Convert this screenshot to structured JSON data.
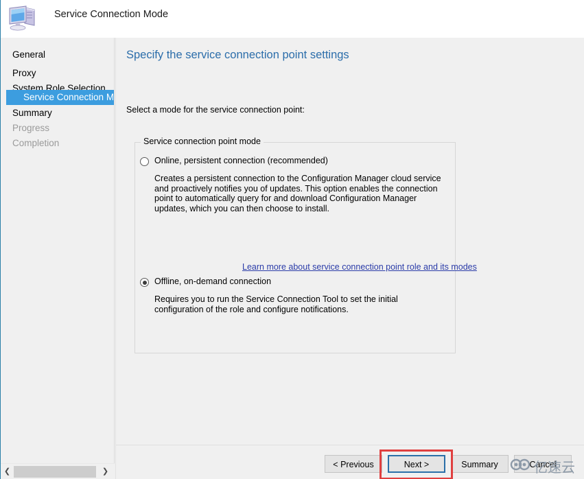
{
  "window": {
    "title": "Service Connection Mode",
    "icon": "computer-icon"
  },
  "sidebar": {
    "items": [
      {
        "label": "General",
        "state": "normal"
      },
      {
        "label": "Proxy",
        "state": "normal"
      },
      {
        "label": "System Role Selection",
        "state": "normal"
      },
      {
        "label": "Service Connection Mode",
        "state": "selected"
      },
      {
        "label": "Summary",
        "state": "normal"
      },
      {
        "label": "Progress",
        "state": "disabled"
      },
      {
        "label": "Completion",
        "state": "disabled"
      }
    ]
  },
  "main": {
    "heading": "Specify the service connection point settings",
    "instruction": "Select a mode for the service connection point:",
    "groupbox_label": "Service connection point mode",
    "options": [
      {
        "label": "Online, persistent connection (recommended)",
        "selected": false,
        "description": "Creates a persistent connection to the Configuration Manager cloud service and proactively notifies you of updates. This option enables the connection point to automatically query for and download Configuration Manager updates, which you can then choose to install."
      },
      {
        "label": "Offline, on-demand connection",
        "selected": true,
        "description": "Requires you to run the Service Connection Tool to set the initial configuration of the role and configure notifications."
      }
    ],
    "learn_more_link": "Learn more about service connection point role and its modes"
  },
  "footer": {
    "previous_label": "< Previous",
    "next_label": "Next >",
    "summary_label": "Summary",
    "cancel_label": "Cancel"
  },
  "scrollbar": {
    "left_arrow": "❮",
    "right_arrow": "❯"
  },
  "watermark": {
    "text": "亿速云"
  },
  "colors": {
    "selection_blue": "#3c9ddf",
    "heading_blue": "#2b6daa",
    "link_blue": "#2a3ba8",
    "annotation_red": "#e04040",
    "panel_gray": "#f0f0f0",
    "focus_border": "#2a6fa8"
  }
}
